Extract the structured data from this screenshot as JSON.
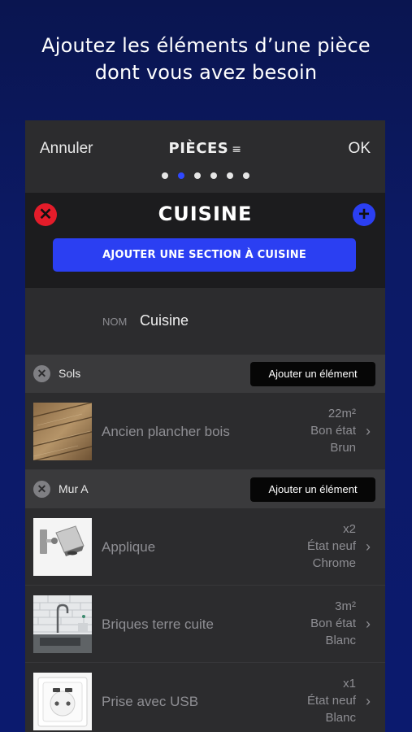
{
  "headline": {
    "line1": "Ajoutez les éléments d’une pièce",
    "line2": "dont vous avez besoin"
  },
  "navbar": {
    "cancel_label": "Annuler",
    "title": "PIÈCES",
    "menu_glyph": "≡",
    "ok_label": "OK",
    "page_count": 6,
    "active_page": 2
  },
  "room": {
    "title": "CUISINE",
    "remove_glyph": "✕",
    "add_glyph": "+",
    "add_section_label": "AJOUTER UNE SECTION À CUISINE",
    "name_label": "NOM",
    "name_value": "Cuisine"
  },
  "sections": [
    {
      "remove_glyph": "✕",
      "name": "Sols",
      "add_label": "Ajouter un élément",
      "items": [
        {
          "name": "Ancien plancher bois",
          "meta1": "22m²",
          "meta2": "Bon état",
          "meta3": "Brun",
          "icon": "wood-floor-photo"
        }
      ]
    },
    {
      "remove_glyph": "✕",
      "name": "Mur A",
      "add_label": "Ajouter un élément",
      "items": [
        {
          "name": "Applique",
          "meta1": "x2",
          "meta2": "État neuf",
          "meta3": "Chrome",
          "icon": "wall-lamp-photo"
        },
        {
          "name": "Briques terre cuite",
          "meta1": "3m²",
          "meta2": "Bon état",
          "meta3": "Blanc",
          "icon": "brick-wall-photo"
        },
        {
          "name": "Prise avec USB",
          "meta1": "x1",
          "meta2": "État neuf",
          "meta3": "Blanc",
          "icon": "usb-outlet-photo"
        }
      ]
    }
  ],
  "colors": {
    "accent_blue": "#2b3ff2",
    "remove_red": "#e41c2a",
    "background_navy": "#0b1a6e"
  }
}
